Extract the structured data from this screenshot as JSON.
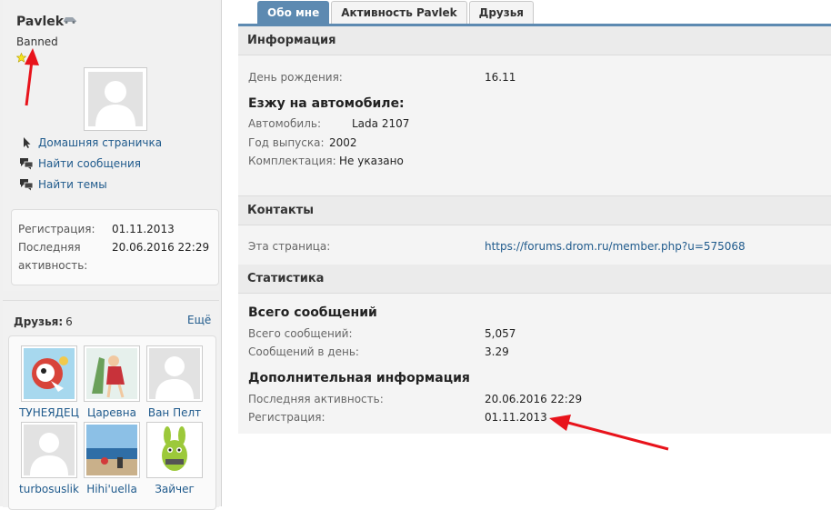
{
  "profile": {
    "username": "Pavlek",
    "status": "Banned",
    "links": [
      {
        "label": "Домашняя страничка"
      },
      {
        "label": "Найти сообщения"
      },
      {
        "label": "Найти темы"
      }
    ],
    "registration_label": "Регистрация:",
    "registration_value": "01.11.2013",
    "last_activity_label_1": "Последняя",
    "last_activity_label_2": "активность:",
    "last_activity_value": "20.06.2016 22:29"
  },
  "friends": {
    "title": "Друзья:",
    "count": "6",
    "more_label": "Ещё",
    "items": [
      {
        "name": "ТУНЕЯДЕЦ"
      },
      {
        "name": "Царевна"
      },
      {
        "name": "Ван Пелт"
      },
      {
        "name": "turbosuslik"
      },
      {
        "name": "Hihi'uella"
      },
      {
        "name": "Зайчег"
      }
    ]
  },
  "tabs": [
    {
      "label": "Обо мне",
      "active": true
    },
    {
      "label": "Активность Pavlek",
      "active": false
    },
    {
      "label": "Друзья",
      "active": false
    }
  ],
  "info": {
    "title": "Информация",
    "birthday_label": "День рождения:",
    "birthday_value": "16.11",
    "car_title": "Езжу на автомобиле:",
    "car_label": "Автомобиль:",
    "car_value": "Lada 2107",
    "year_label": "Год выпуска:",
    "year_value": "2002",
    "trim_label": "Комплектация:",
    "trim_value": "Не указано"
  },
  "contacts": {
    "title": "Контакты",
    "page_label": "Эта страница:",
    "page_value": "https://forums.drom.ru/member.php?u=575068"
  },
  "stats": {
    "title": "Статистика",
    "total_title": "Всего сообщений",
    "total_label": "Всего сообщений:",
    "total_value": "5,057",
    "per_day_label": "Сообщений в день:",
    "per_day_value": "3.29",
    "extra_title": "Дополнительная информация",
    "last_activity_label": "Последняя активность:",
    "last_activity_value": "20.06.2016 22:29",
    "registration_label": "Регистрация:",
    "registration_value": "01.11.2013"
  },
  "colors": {
    "accent": "#5d8ab1",
    "link": "#1f5a8c",
    "annotation_arrow": "#e8131b"
  }
}
